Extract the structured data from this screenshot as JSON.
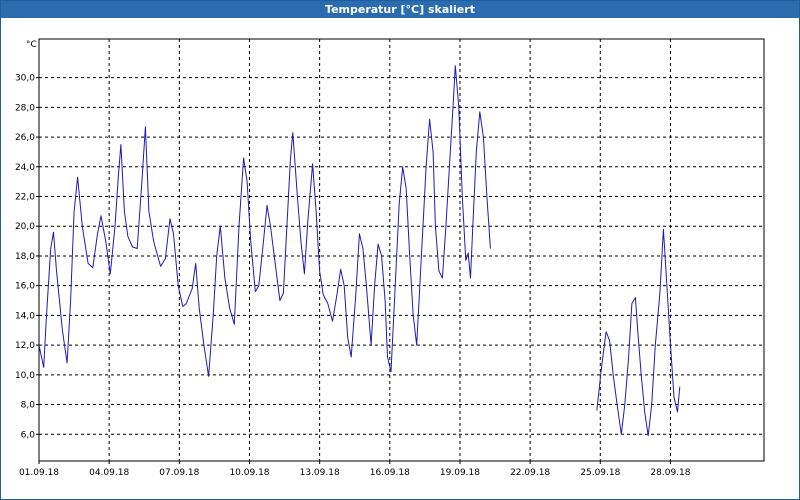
{
  "window": {
    "title": "Temperatur [°C] skaliert"
  },
  "chart_data": {
    "type": "line",
    "title": "Temperatur [°C] skaliert",
    "ylabel": "°C",
    "xlabel": "",
    "ylim": [
      4.2,
      32.6
    ],
    "xlim": [
      0,
      31
    ],
    "grid": true,
    "x_ticks": [
      {
        "x": 0,
        "label": "01.09.18"
      },
      {
        "x": 3,
        "label": "04.09.18"
      },
      {
        "x": 6,
        "label": "07.09.18"
      },
      {
        "x": 9,
        "label": "10.09.18"
      },
      {
        "x": 12,
        "label": "13.09.18"
      },
      {
        "x": 15,
        "label": "16.09.18"
      },
      {
        "x": 18,
        "label": "19.09.18"
      },
      {
        "x": 21,
        "label": "22.09.18"
      },
      {
        "x": 24,
        "label": "25.09.18"
      },
      {
        "x": 27,
        "label": "28.09.18"
      }
    ],
    "y_ticks": [
      {
        "y": 6,
        "label": "6,0"
      },
      {
        "y": 8,
        "label": "8,0"
      },
      {
        "y": 10,
        "label": "10,0"
      },
      {
        "y": 12,
        "label": "12,0"
      },
      {
        "y": 14,
        "label": "14,0"
      },
      {
        "y": 16,
        "label": "16,0"
      },
      {
        "y": 18,
        "label": "18,0"
      },
      {
        "y": 20,
        "label": "20,0"
      },
      {
        "y": 22,
        "label": "22,0"
      },
      {
        "y": 24,
        "label": "24,0"
      },
      {
        "y": 26,
        "label": "26,0"
      },
      {
        "y": 28,
        "label": "28,0"
      },
      {
        "y": 30,
        "label": "30,0"
      }
    ],
    "series": [
      {
        "color": "#1c1cb4",
        "segments": [
          [
            [
              0.0,
              12.0
            ],
            [
              0.2,
              10.5
            ],
            [
              0.32,
              14.0
            ],
            [
              0.5,
              18.5
            ],
            [
              0.62,
              19.6
            ],
            [
              0.75,
              17.0
            ],
            [
              1.0,
              13.0
            ],
            [
              1.2,
              10.8
            ],
            [
              1.35,
              15.0
            ],
            [
              1.5,
              21.0
            ],
            [
              1.65,
              23.3
            ],
            [
              1.85,
              20.0
            ],
            [
              2.1,
              17.5
            ],
            [
              2.3,
              17.2
            ],
            [
              2.5,
              19.5
            ],
            [
              2.65,
              20.7
            ],
            [
              2.85,
              19.0
            ],
            [
              3.05,
              16.8
            ],
            [
              3.25,
              20.0
            ],
            [
              3.4,
              23.5
            ],
            [
              3.5,
              25.5
            ],
            [
              3.65,
              21.0
            ],
            [
              3.8,
              19.3
            ],
            [
              4.0,
              18.6
            ],
            [
              4.2,
              18.5
            ],
            [
              4.4,
              23.0
            ],
            [
              4.55,
              26.7
            ],
            [
              4.7,
              21.0
            ],
            [
              4.9,
              19.0
            ],
            [
              5.2,
              17.3
            ],
            [
              5.4,
              17.8
            ],
            [
              5.6,
              20.5
            ],
            [
              5.75,
              19.5
            ],
            [
              5.95,
              16.0
            ],
            [
              6.15,
              14.6
            ],
            [
              6.3,
              14.8
            ],
            [
              6.55,
              15.8
            ],
            [
              6.7,
              17.5
            ],
            [
              6.85,
              14.5
            ],
            [
              7.05,
              12.0
            ],
            [
              7.25,
              9.9
            ],
            [
              7.45,
              14.0
            ],
            [
              7.6,
              18.0
            ],
            [
              7.75,
              20.0
            ],
            [
              7.95,
              16.5
            ],
            [
              8.15,
              14.5
            ],
            [
              8.35,
              13.4
            ],
            [
              8.55,
              20.0
            ],
            [
              8.75,
              24.6
            ],
            [
              8.9,
              23.0
            ],
            [
              9.05,
              19.0
            ],
            [
              9.25,
              15.6
            ],
            [
              9.4,
              16.0
            ],
            [
              9.6,
              19.0
            ],
            [
              9.75,
              21.4
            ],
            [
              9.9,
              20.0
            ],
            [
              10.1,
              17.5
            ],
            [
              10.3,
              15.0
            ],
            [
              10.45,
              15.5
            ],
            [
              10.6,
              20.0
            ],
            [
              10.75,
              24.5
            ],
            [
              10.85,
              26.3
            ],
            [
              11.05,
              22.0
            ],
            [
              11.2,
              19.0
            ],
            [
              11.35,
              16.8
            ],
            [
              11.5,
              20.5
            ],
            [
              11.7,
              24.2
            ],
            [
              11.85,
              21.0
            ],
            [
              12.0,
              17.0
            ],
            [
              12.15,
              15.4
            ],
            [
              12.35,
              14.8
            ],
            [
              12.55,
              13.6
            ],
            [
              12.75,
              15.5
            ],
            [
              12.9,
              17.1
            ],
            [
              13.05,
              16.0
            ],
            [
              13.2,
              12.5
            ],
            [
              13.35,
              11.2
            ],
            [
              13.55,
              15.5
            ],
            [
              13.7,
              19.5
            ],
            [
              13.85,
              18.5
            ],
            [
              14.0,
              16.0
            ],
            [
              14.2,
              12.0
            ],
            [
              14.35,
              16.0
            ],
            [
              14.5,
              18.8
            ],
            [
              14.65,
              18.0
            ],
            [
              14.8,
              15.0
            ],
            [
              14.9,
              11.2
            ],
            [
              15.05,
              10.2
            ],
            [
              15.2,
              15.0
            ],
            [
              15.4,
              21.5
            ],
            [
              15.55,
              24.0
            ],
            [
              15.7,
              22.5
            ],
            [
              15.85,
              18.0
            ],
            [
              16.0,
              14.0
            ],
            [
              16.15,
              12.0
            ],
            [
              16.35,
              18.0
            ],
            [
              16.55,
              24.0
            ],
            [
              16.7,
              27.2
            ],
            [
              16.85,
              25.0
            ],
            [
              16.95,
              20.0
            ],
            [
              17.1,
              17.0
            ],
            [
              17.25,
              16.5
            ],
            [
              17.4,
              20.0
            ],
            [
              17.55,
              24.0
            ],
            [
              17.7,
              28.0
            ],
            [
              17.8,
              30.8
            ],
            [
              17.95,
              28.0
            ],
            [
              18.1,
              22.0
            ],
            [
              18.25,
              17.7
            ],
            [
              18.35,
              18.2
            ],
            [
              18.45,
              16.5
            ],
            [
              18.55,
              20.0
            ],
            [
              18.7,
              25.0
            ],
            [
              18.85,
              27.7
            ],
            [
              19.0,
              26.0
            ],
            [
              19.15,
              22.0
            ],
            [
              19.3,
              18.5
            ]
          ],
          [
            [
              23.85,
              7.6
            ],
            [
              24.05,
              10.5
            ],
            [
              24.25,
              12.9
            ],
            [
              24.4,
              12.3
            ],
            [
              24.55,
              10.0
            ],
            [
              24.7,
              8.2
            ],
            [
              24.9,
              6.0
            ],
            [
              25.05,
              8.0
            ],
            [
              25.2,
              11.0
            ],
            [
              25.35,
              14.8
            ],
            [
              25.5,
              15.2
            ],
            [
              25.6,
              13.0
            ],
            [
              25.75,
              10.0
            ],
            [
              25.9,
              7.5
            ],
            [
              26.05,
              5.9
            ],
            [
              26.2,
              8.0
            ],
            [
              26.35,
              12.0
            ],
            [
              26.55,
              15.5
            ],
            [
              26.7,
              19.8
            ],
            [
              26.85,
              16.0
            ],
            [
              27.0,
              12.0
            ],
            [
              27.15,
              8.5
            ],
            [
              27.3,
              7.5
            ],
            [
              27.4,
              9.2
            ]
          ]
        ]
      }
    ]
  }
}
